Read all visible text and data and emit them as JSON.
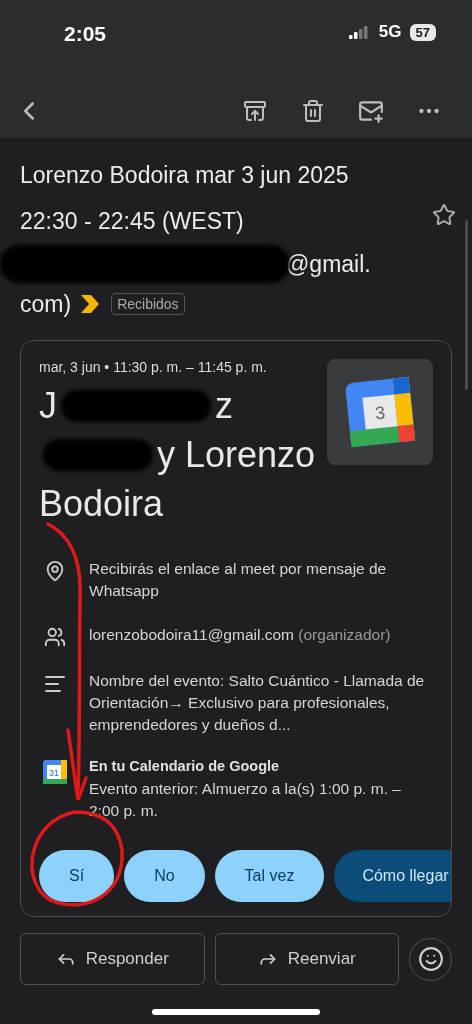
{
  "status_bar": {
    "time": "2:05",
    "network": "5G",
    "battery": "57"
  },
  "subject": {
    "lines": [
      "Lorenzo Bodoira mar 3 jun 2025",
      "22:30 - 22:45 (WEST)"
    ],
    "starred": false
  },
  "sender": {
    "visible_text": "@gmail.",
    "second_line": "com)",
    "label": "Recibidos"
  },
  "event_card": {
    "date": "mar, 3 jun • 11:30 p. m. – 11:45 p. m.",
    "title_lines": [
      [
        {
          "kind": "text",
          "text": "J"
        },
        {
          "kind": "redaction"
        },
        {
          "kind": "text",
          "text": "z"
        }
      ],
      [
        {
          "kind": "redaction"
        },
        {
          "kind": "text",
          "text": "y Lorenzo"
        }
      ],
      [
        {
          "kind": "text",
          "text": "Bodoira"
        }
      ]
    ],
    "details": [
      {
        "kind": "location",
        "text": "Recibirás el enlace al meet por mensaje de Whatsapp"
      },
      {
        "kind": "people",
        "text": "lorenzobodoira11@gmail.com",
        "note": "(organizador)"
      },
      {
        "kind": "description",
        "text": "Nombre del evento: Salto Cuántico - Llamada de Orientación→ Exclusivo para profesionales, emprendedores y dueños d..."
      },
      {
        "kind": "calendar",
        "heading": "En tu Calendario de Google",
        "text": "Evento anterior: Almuerzo a la(s) 1:00 p. m. – 2:00 p. m.",
        "icon_text": "31"
      }
    ],
    "rsvp": [
      {
        "label": "Sí",
        "kind": "light"
      },
      {
        "label": "No",
        "kind": "light"
      },
      {
        "label": "Tal vez",
        "kind": "light"
      },
      {
        "label": "Cómo llegar",
        "kind": "dark"
      }
    ]
  },
  "actions": [
    {
      "label": "Responder",
      "kind": "reply"
    },
    {
      "label": "Reenviar",
      "kind": "forward"
    }
  ],
  "calendar_logo_text": "3"
}
